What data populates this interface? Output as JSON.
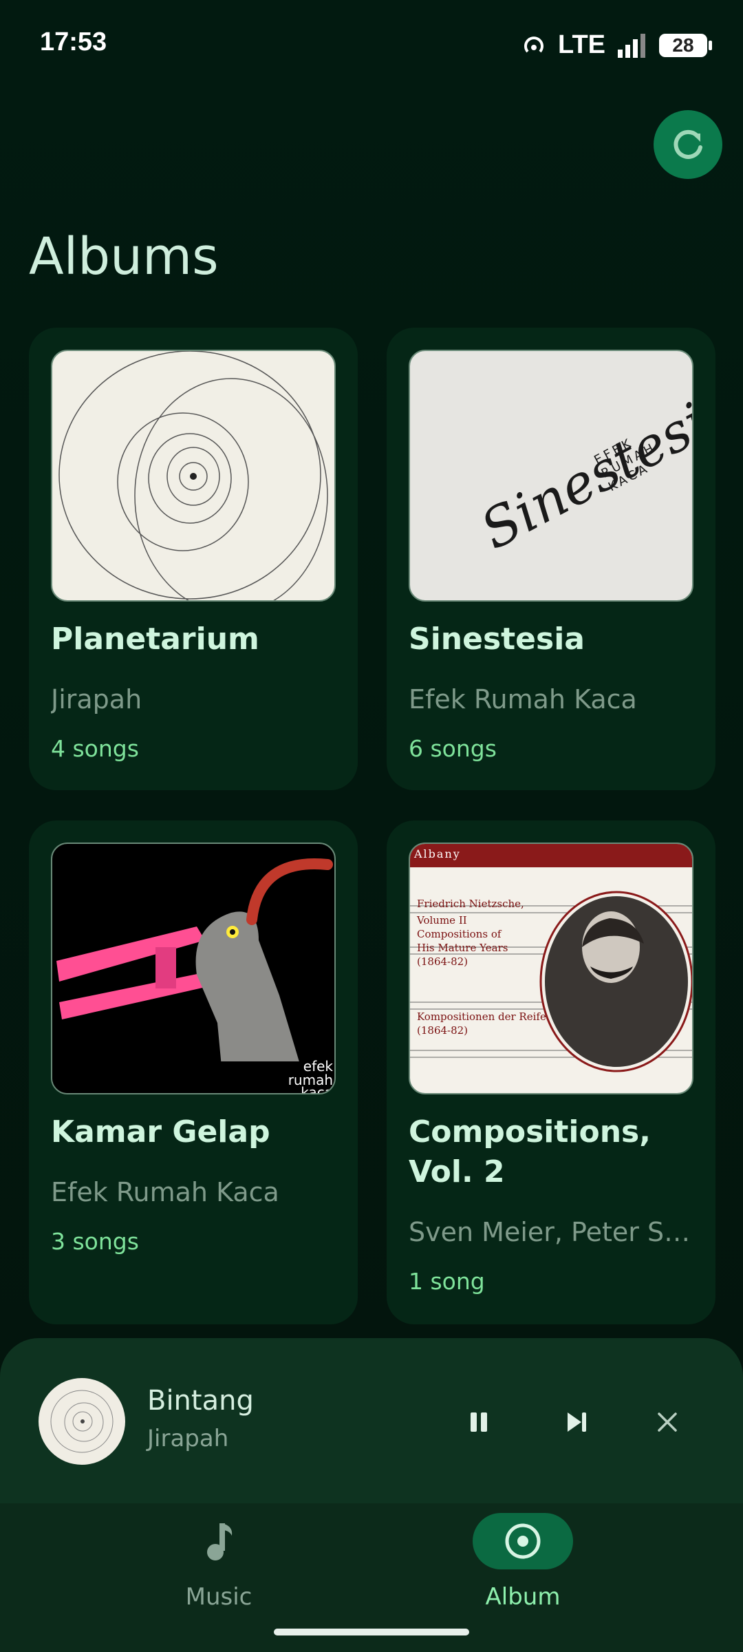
{
  "status_bar": {
    "time": "17:53",
    "network": "LTE",
    "battery": "28"
  },
  "header": {
    "title": "Albums"
  },
  "albums": [
    {
      "title": "Planetarium",
      "artist": "Jirapah",
      "count": "4 songs"
    },
    {
      "title": "Sinestesia",
      "artist": "Efek Rumah Kaca",
      "count": "6 songs",
      "art_text": "Sinestesia",
      "art_subtext": [
        "EFEK",
        "RUMAH",
        "KACA"
      ]
    },
    {
      "title": "Kamar Gelap",
      "artist": "Efek Rumah Kaca",
      "count": "3 songs",
      "art_text": [
        "efek",
        "rumah",
        "kaca"
      ]
    },
    {
      "title": "Compositions, Vol. 2",
      "artist": "Sven Meier, Peter Sc...",
      "count": "1 song",
      "art_lines": [
        "Friedrich Nietzsche,",
        "Volume II",
        "Compositions of",
        "His Mature Years",
        "(1864-82)",
        "Kompositionen der Reife",
        "(1864-82)"
      ],
      "art_banner": "Albany"
    }
  ],
  "now_playing": {
    "title": "Bintang",
    "artist": "Jirapah"
  },
  "nav": {
    "music_label": "Music",
    "album_label": "Album"
  },
  "colors": {
    "accent": "#7fe39b",
    "fab": "#0b7a4c",
    "active_pill": "#0b6a42"
  }
}
